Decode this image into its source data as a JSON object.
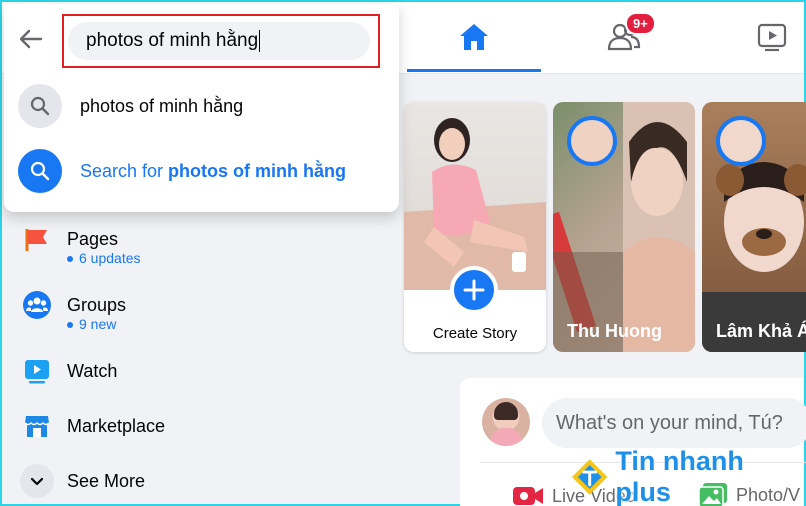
{
  "search": {
    "query": "photos of minh hằng",
    "suggestion": "photos of minh hằng",
    "search_for_prefix": "Search for ",
    "search_for_query": "photos of minh hằng"
  },
  "nav": {
    "friends_badge": "9+"
  },
  "sidebar": {
    "items": [
      {
        "label": "Pages",
        "sub": "6 updates",
        "icon": "pages-icon"
      },
      {
        "label": "Groups",
        "sub": "9 new",
        "icon": "groups-icon"
      },
      {
        "label": "Watch",
        "icon": "watch-icon"
      },
      {
        "label": "Marketplace",
        "icon": "marketplace-icon"
      },
      {
        "label": "See More",
        "icon": "chevron-down-icon"
      }
    ]
  },
  "stories": [
    {
      "name": "Create Story"
    },
    {
      "name": "Thu Huong"
    },
    {
      "name": "Lâm Khả Á"
    }
  ],
  "composer": {
    "placeholder": "What's on your mind, Tú?",
    "live_video": "Live Video",
    "photo_video": "Photo/V"
  },
  "watermark": "Tin nhanh plus",
  "colors": {
    "accent": "#1877f2",
    "badge": "#e41e3f",
    "highlight_border": "#e02020",
    "frame": "#2bd4e6"
  }
}
